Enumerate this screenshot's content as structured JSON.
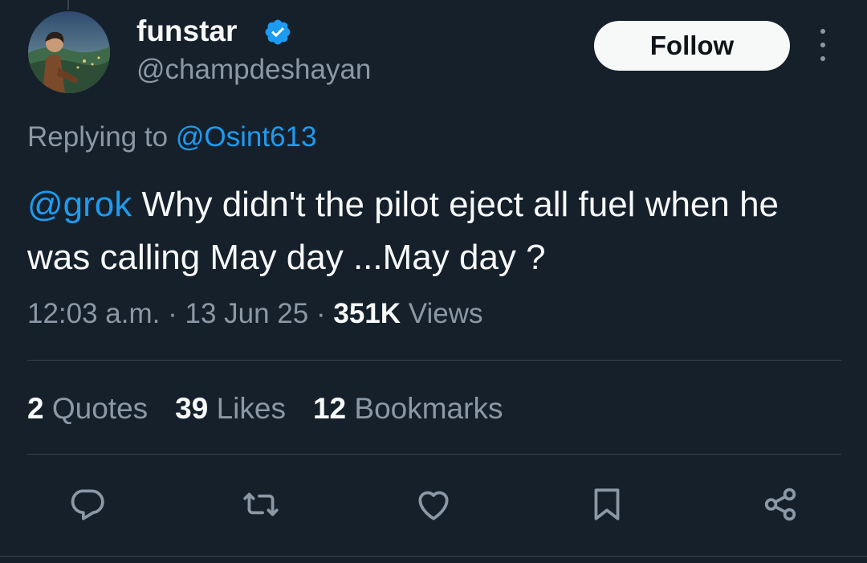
{
  "author": {
    "display_name": "funstar",
    "handle": "@champdeshayan",
    "verified": true,
    "avatar_icon": "avatar-landscape-illustration"
  },
  "header": {
    "follow_label": "Follow",
    "more_icon": "more-options-icon"
  },
  "reply_context": {
    "prefix": "Replying to ",
    "mention": "@Osint613"
  },
  "tweet": {
    "mention": "@grok",
    "text": " Why didn't the pilot eject all fuel when he was calling May day ...May day ?"
  },
  "meta": {
    "time": "12:03 a.m.",
    "separator": " · ",
    "date": "13 Jun 25",
    "views_count": "351K",
    "views_label": " Views"
  },
  "stats": {
    "quotes_count": "2",
    "quotes_label": " Quotes",
    "likes_count": "39",
    "likes_label": " Likes",
    "bookmarks_count": "12",
    "bookmarks_label": " Bookmarks"
  },
  "actions": [
    "reply-icon",
    "retweet-icon",
    "like-icon",
    "bookmark-icon",
    "share-icon"
  ],
  "colors": {
    "background": "#15202b",
    "link": "#1d9bf0",
    "muted": "#8b98a5",
    "text": "#f7f9f9",
    "divider": "#38444d"
  }
}
